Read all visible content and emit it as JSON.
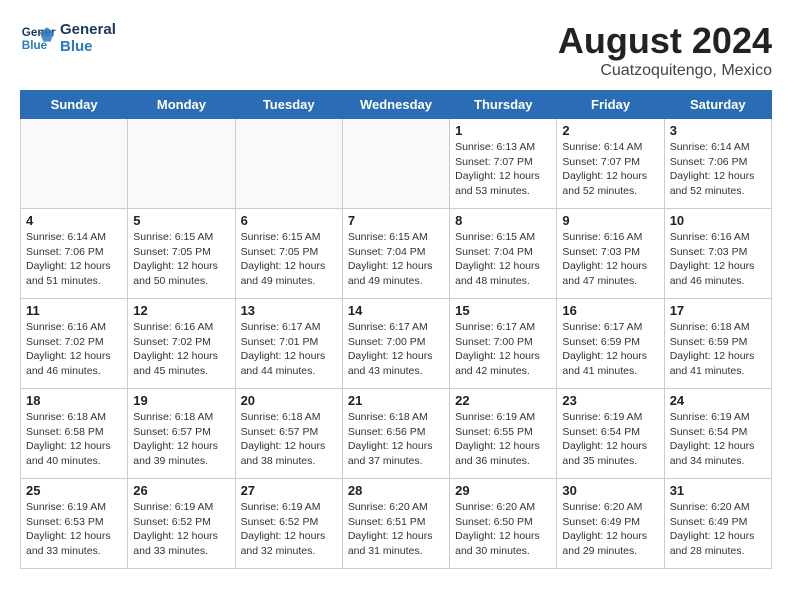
{
  "header": {
    "logo_line1": "General",
    "logo_line2": "Blue",
    "month": "August 2024",
    "location": "Cuatzoquitengo, Mexico"
  },
  "days_of_week": [
    "Sunday",
    "Monday",
    "Tuesday",
    "Wednesday",
    "Thursday",
    "Friday",
    "Saturday"
  ],
  "weeks": [
    [
      {
        "day": "",
        "info": ""
      },
      {
        "day": "",
        "info": ""
      },
      {
        "day": "",
        "info": ""
      },
      {
        "day": "",
        "info": ""
      },
      {
        "day": "1",
        "info": "Sunrise: 6:13 AM\nSunset: 7:07 PM\nDaylight: 12 hours\nand 53 minutes."
      },
      {
        "day": "2",
        "info": "Sunrise: 6:14 AM\nSunset: 7:07 PM\nDaylight: 12 hours\nand 52 minutes."
      },
      {
        "day": "3",
        "info": "Sunrise: 6:14 AM\nSunset: 7:06 PM\nDaylight: 12 hours\nand 52 minutes."
      }
    ],
    [
      {
        "day": "4",
        "info": "Sunrise: 6:14 AM\nSunset: 7:06 PM\nDaylight: 12 hours\nand 51 minutes."
      },
      {
        "day": "5",
        "info": "Sunrise: 6:15 AM\nSunset: 7:05 PM\nDaylight: 12 hours\nand 50 minutes."
      },
      {
        "day": "6",
        "info": "Sunrise: 6:15 AM\nSunset: 7:05 PM\nDaylight: 12 hours\nand 49 minutes."
      },
      {
        "day": "7",
        "info": "Sunrise: 6:15 AM\nSunset: 7:04 PM\nDaylight: 12 hours\nand 49 minutes."
      },
      {
        "day": "8",
        "info": "Sunrise: 6:15 AM\nSunset: 7:04 PM\nDaylight: 12 hours\nand 48 minutes."
      },
      {
        "day": "9",
        "info": "Sunrise: 6:16 AM\nSunset: 7:03 PM\nDaylight: 12 hours\nand 47 minutes."
      },
      {
        "day": "10",
        "info": "Sunrise: 6:16 AM\nSunset: 7:03 PM\nDaylight: 12 hours\nand 46 minutes."
      }
    ],
    [
      {
        "day": "11",
        "info": "Sunrise: 6:16 AM\nSunset: 7:02 PM\nDaylight: 12 hours\nand 46 minutes."
      },
      {
        "day": "12",
        "info": "Sunrise: 6:16 AM\nSunset: 7:02 PM\nDaylight: 12 hours\nand 45 minutes."
      },
      {
        "day": "13",
        "info": "Sunrise: 6:17 AM\nSunset: 7:01 PM\nDaylight: 12 hours\nand 44 minutes."
      },
      {
        "day": "14",
        "info": "Sunrise: 6:17 AM\nSunset: 7:00 PM\nDaylight: 12 hours\nand 43 minutes."
      },
      {
        "day": "15",
        "info": "Sunrise: 6:17 AM\nSunset: 7:00 PM\nDaylight: 12 hours\nand 42 minutes."
      },
      {
        "day": "16",
        "info": "Sunrise: 6:17 AM\nSunset: 6:59 PM\nDaylight: 12 hours\nand 41 minutes."
      },
      {
        "day": "17",
        "info": "Sunrise: 6:18 AM\nSunset: 6:59 PM\nDaylight: 12 hours\nand 41 minutes."
      }
    ],
    [
      {
        "day": "18",
        "info": "Sunrise: 6:18 AM\nSunset: 6:58 PM\nDaylight: 12 hours\nand 40 minutes."
      },
      {
        "day": "19",
        "info": "Sunrise: 6:18 AM\nSunset: 6:57 PM\nDaylight: 12 hours\nand 39 minutes."
      },
      {
        "day": "20",
        "info": "Sunrise: 6:18 AM\nSunset: 6:57 PM\nDaylight: 12 hours\nand 38 minutes."
      },
      {
        "day": "21",
        "info": "Sunrise: 6:18 AM\nSunset: 6:56 PM\nDaylight: 12 hours\nand 37 minutes."
      },
      {
        "day": "22",
        "info": "Sunrise: 6:19 AM\nSunset: 6:55 PM\nDaylight: 12 hours\nand 36 minutes."
      },
      {
        "day": "23",
        "info": "Sunrise: 6:19 AM\nSunset: 6:54 PM\nDaylight: 12 hours\nand 35 minutes."
      },
      {
        "day": "24",
        "info": "Sunrise: 6:19 AM\nSunset: 6:54 PM\nDaylight: 12 hours\nand 34 minutes."
      }
    ],
    [
      {
        "day": "25",
        "info": "Sunrise: 6:19 AM\nSunset: 6:53 PM\nDaylight: 12 hours\nand 33 minutes."
      },
      {
        "day": "26",
        "info": "Sunrise: 6:19 AM\nSunset: 6:52 PM\nDaylight: 12 hours\nand 33 minutes."
      },
      {
        "day": "27",
        "info": "Sunrise: 6:19 AM\nSunset: 6:52 PM\nDaylight: 12 hours\nand 32 minutes."
      },
      {
        "day": "28",
        "info": "Sunrise: 6:20 AM\nSunset: 6:51 PM\nDaylight: 12 hours\nand 31 minutes."
      },
      {
        "day": "29",
        "info": "Sunrise: 6:20 AM\nSunset: 6:50 PM\nDaylight: 12 hours\nand 30 minutes."
      },
      {
        "day": "30",
        "info": "Sunrise: 6:20 AM\nSunset: 6:49 PM\nDaylight: 12 hours\nand 29 minutes."
      },
      {
        "day": "31",
        "info": "Sunrise: 6:20 AM\nSunset: 6:49 PM\nDaylight: 12 hours\nand 28 minutes."
      }
    ]
  ]
}
